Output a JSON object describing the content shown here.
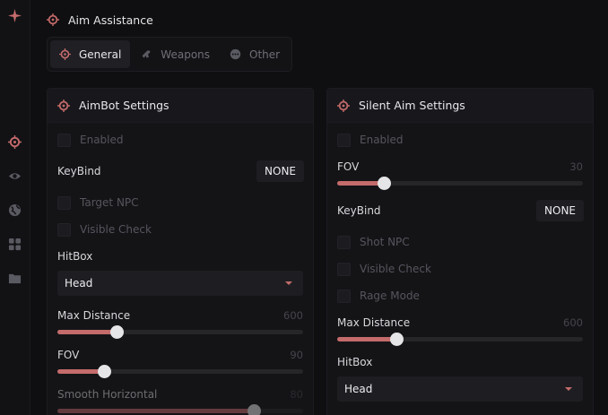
{
  "colors": {
    "accent": "#c46b6b",
    "background": "#0f0f11",
    "panel": "#141417"
  },
  "sidebar": {
    "items": [
      {
        "icon": "logo-star-icon"
      },
      {
        "icon": "crosshair-icon"
      },
      {
        "icon": "eye-icon"
      },
      {
        "icon": "globe-icon"
      },
      {
        "icon": "grid-icon"
      },
      {
        "icon": "folder-icon"
      }
    ]
  },
  "header": {
    "title": "Aim Assistance"
  },
  "tabs": [
    {
      "label": "General",
      "active": true
    },
    {
      "label": "Weapons",
      "active": false
    },
    {
      "label": "Other",
      "active": false
    }
  ],
  "aimbot": {
    "title": "AimBot Settings",
    "enabled_label": "Enabled",
    "keybind_label": "KeyBind",
    "keybind_value": "NONE",
    "target_npc_label": "Target NPC",
    "visible_check_label": "Visible Check",
    "hitbox_label": "HitBox",
    "hitbox_value": "Head",
    "max_distance": {
      "label": "Max Distance",
      "value": "600",
      "fill_fraction": 0.24
    },
    "fov": {
      "label": "FOV",
      "value": "90",
      "fill_fraction": 0.19
    },
    "smooth_horizontal": {
      "label": "Smooth Horizontal",
      "value": "80",
      "fill_fraction": 0.8
    }
  },
  "silent": {
    "title": "Silent Aim Settings",
    "enabled_label": "Enabled",
    "fov": {
      "label": "FOV",
      "value": "30",
      "fill_fraction": 0.19
    },
    "keybind_label": "KeyBind",
    "keybind_value": "NONE",
    "shot_npc_label": "Shot NPC",
    "visible_check_label": "Visible Check",
    "rage_mode_label": "Rage Mode",
    "max_distance": {
      "label": "Max Distance",
      "value": "600",
      "fill_fraction": 0.24
    },
    "hitbox_label": "HitBox",
    "hitbox_value": "Head"
  }
}
